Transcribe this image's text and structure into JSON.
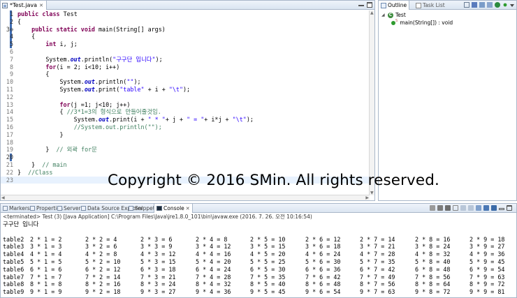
{
  "editor": {
    "tab_label": "*Test.java",
    "tab_close": "✕",
    "lines": [
      {
        "n": "1",
        "hl": true,
        "segs": [
          {
            "c": "kw",
            "t": "public"
          },
          {
            "c": "",
            "t": " "
          },
          {
            "c": "kw",
            "t": "class"
          },
          {
            "c": "",
            "t": " Test"
          }
        ]
      },
      {
        "n": "2",
        "hl": true,
        "segs": [
          {
            "c": "",
            "t": "{"
          }
        ]
      },
      {
        "n": "3⊖",
        "hl": true,
        "segs": [
          {
            "c": "",
            "t": "    "
          },
          {
            "c": "kw",
            "t": "public"
          },
          {
            "c": "",
            "t": " "
          },
          {
            "c": "kw",
            "t": "static"
          },
          {
            "c": "",
            "t": " "
          },
          {
            "c": "kw",
            "t": "void"
          },
          {
            "c": "",
            "t": " main(String[] args)"
          }
        ]
      },
      {
        "n": "4",
        "hl": true,
        "segs": [
          {
            "c": "",
            "t": "    {"
          }
        ]
      },
      {
        "n": "5",
        "hl": true,
        "segs": [
          {
            "c": "",
            "t": "        "
          },
          {
            "c": "kw",
            "t": "int"
          },
          {
            "c": "",
            "t": " i, j;"
          }
        ]
      },
      {
        "n": "6",
        "hl": false,
        "segs": []
      },
      {
        "n": "7",
        "hl": false,
        "segs": [
          {
            "c": "",
            "t": "        System."
          },
          {
            "c": "fld",
            "t": "out"
          },
          {
            "c": "",
            "t": ".println("
          },
          {
            "c": "str",
            "t": "\"구구단 입니다\""
          },
          {
            "c": "",
            "t": ");"
          }
        ]
      },
      {
        "n": "8",
        "hl": false,
        "segs": [
          {
            "c": "",
            "t": "        "
          },
          {
            "c": "kw",
            "t": "for"
          },
          {
            "c": "",
            "t": "(i = 2; i<10; i++)"
          }
        ]
      },
      {
        "n": "9",
        "hl": false,
        "segs": [
          {
            "c": "",
            "t": "        {"
          }
        ]
      },
      {
        "n": "10",
        "hl": false,
        "segs": [
          {
            "c": "",
            "t": "            System."
          },
          {
            "c": "fld",
            "t": "out"
          },
          {
            "c": "",
            "t": ".println("
          },
          {
            "c": "str",
            "t": "\"\""
          },
          {
            "c": "",
            "t": ");"
          }
        ]
      },
      {
        "n": "11",
        "hl": false,
        "segs": [
          {
            "c": "",
            "t": "            System."
          },
          {
            "c": "fld",
            "t": "out"
          },
          {
            "c": "",
            "t": ".print("
          },
          {
            "c": "str",
            "t": "\"table\""
          },
          {
            "c": "",
            "t": " + i + "
          },
          {
            "c": "str",
            "t": "\"\\t\""
          },
          {
            "c": "",
            "t": ");"
          }
        ]
      },
      {
        "n": "12",
        "hl": false,
        "segs": []
      },
      {
        "n": "13",
        "hl": false,
        "segs": [
          {
            "c": "",
            "t": "            "
          },
          {
            "c": "kw",
            "t": "for"
          },
          {
            "c": "",
            "t": "(j =1; j<10; j++)"
          }
        ]
      },
      {
        "n": "14",
        "hl": false,
        "segs": [
          {
            "c": "",
            "t": "            { "
          },
          {
            "c": "cm",
            "t": "//3*1=3의 형식으로 만들어줄것임."
          }
        ]
      },
      {
        "n": "15",
        "hl": false,
        "segs": [
          {
            "c": "",
            "t": "                System."
          },
          {
            "c": "fld",
            "t": "out"
          },
          {
            "c": "",
            "t": ".print(i + "
          },
          {
            "c": "str",
            "t": "\" * \""
          },
          {
            "c": "",
            "t": "+ j + "
          },
          {
            "c": "str",
            "t": "\" = \""
          },
          {
            "c": "",
            "t": "+ i*j + "
          },
          {
            "c": "str",
            "t": "\"\\t\""
          },
          {
            "c": "",
            "t": ");"
          }
        ]
      },
      {
        "n": "16",
        "hl": false,
        "segs": [
          {
            "c": "",
            "t": "                "
          },
          {
            "c": "cm",
            "t": "//System.out.println(\"\");"
          }
        ]
      },
      {
        "n": "17",
        "hl": false,
        "segs": [
          {
            "c": "",
            "t": "            }"
          }
        ]
      },
      {
        "n": "18",
        "hl": false,
        "segs": []
      },
      {
        "n": "19",
        "hl": false,
        "segs": [
          {
            "c": "",
            "t": "        }  "
          },
          {
            "c": "cm",
            "t": "// 외곽 for문"
          }
        ]
      },
      {
        "n": "20",
        "hl": true,
        "segs": []
      },
      {
        "n": "21",
        "hl": false,
        "segs": [
          {
            "c": "",
            "t": "    }  "
          },
          {
            "c": "cm",
            "t": "// main"
          }
        ]
      },
      {
        "n": "22",
        "hl": false,
        "segs": [
          {
            "c": "",
            "t": "}  "
          },
          {
            "c": "cm",
            "t": "//Class"
          }
        ]
      },
      {
        "n": "23",
        "hl": false,
        "cur": true,
        "segs": []
      }
    ]
  },
  "outline": {
    "tab_outline": "Outline",
    "tab_tasks": "Task List",
    "class_name": "Test",
    "method_name": "main(String[]) : void"
  },
  "console": {
    "tabs": [
      "Markers",
      "Properties",
      "Servers",
      "Data Source Explorer",
      "Snippets",
      "Console"
    ],
    "terminated": "<terminated> Test (3) [Java Application] C:\\Program Files\\Java\\jre1.8.0_101\\bin\\javaw.exe (2016. 7. 26. 오전 10:16:54)",
    "header": "구구단 입니다",
    "rows": [
      {
        "label": "table2",
        "cells": [
          "2 * 1 = 2",
          "2 * 2 = 4",
          "2 * 3 = 6",
          "2 * 4 = 8",
          "2 * 5 = 10",
          "2 * 6 = 12",
          "2 * 7 = 14",
          "2 * 8 = 16",
          "2 * 9 = 18"
        ]
      },
      {
        "label": "table3",
        "cells": [
          "3 * 1 = 3",
          "3 * 2 = 6",
          "3 * 3 = 9",
          "3 * 4 = 12",
          "3 * 5 = 15",
          "3 * 6 = 18",
          "3 * 7 = 21",
          "3 * 8 = 24",
          "3 * 9 = 27"
        ]
      },
      {
        "label": "table4",
        "cells": [
          "4 * 1 = 4",
          "4 * 2 = 8",
          "4 * 3 = 12",
          "4 * 4 = 16",
          "4 * 5 = 20",
          "4 * 6 = 24",
          "4 * 7 = 28",
          "4 * 8 = 32",
          "4 * 9 = 36"
        ]
      },
      {
        "label": "table5",
        "cells": [
          "5 * 1 = 5",
          "5 * 2 = 10",
          "5 * 3 = 15",
          "5 * 4 = 20",
          "5 * 5 = 25",
          "5 * 6 = 30",
          "5 * 7 = 35",
          "5 * 8 = 40",
          "5 * 9 = 45"
        ]
      },
      {
        "label": "table6",
        "cells": [
          "6 * 1 = 6",
          "6 * 2 = 12",
          "6 * 3 = 18",
          "6 * 4 = 24",
          "6 * 5 = 30",
          "6 * 6 = 36",
          "6 * 7 = 42",
          "6 * 8 = 48",
          "6 * 9 = 54"
        ]
      },
      {
        "label": "table7",
        "cells": [
          "7 * 1 = 7",
          "7 * 2 = 14",
          "7 * 3 = 21",
          "7 * 4 = 28",
          "7 * 5 = 35",
          "7 * 6 = 42",
          "7 * 7 = 49",
          "7 * 8 = 56",
          "7 * 9 = 63"
        ]
      },
      {
        "label": "table8",
        "cells": [
          "8 * 1 = 8",
          "8 * 2 = 16",
          "8 * 3 = 24",
          "8 * 4 = 32",
          "8 * 5 = 40",
          "8 * 6 = 48",
          "8 * 7 = 56",
          "8 * 8 = 64",
          "8 * 9 = 72"
        ]
      },
      {
        "label": "table9",
        "cells": [
          "9 * 1 = 9",
          "9 * 2 = 18",
          "9 * 3 = 27",
          "9 * 4 = 36",
          "9 * 5 = 45",
          "9 * 6 = 54",
          "9 * 7 = 63",
          "9 * 8 = 72",
          "9 * 9 = 81"
        ]
      }
    ]
  },
  "watermark": "Copyright © 2016 SMin. All rights reserved."
}
